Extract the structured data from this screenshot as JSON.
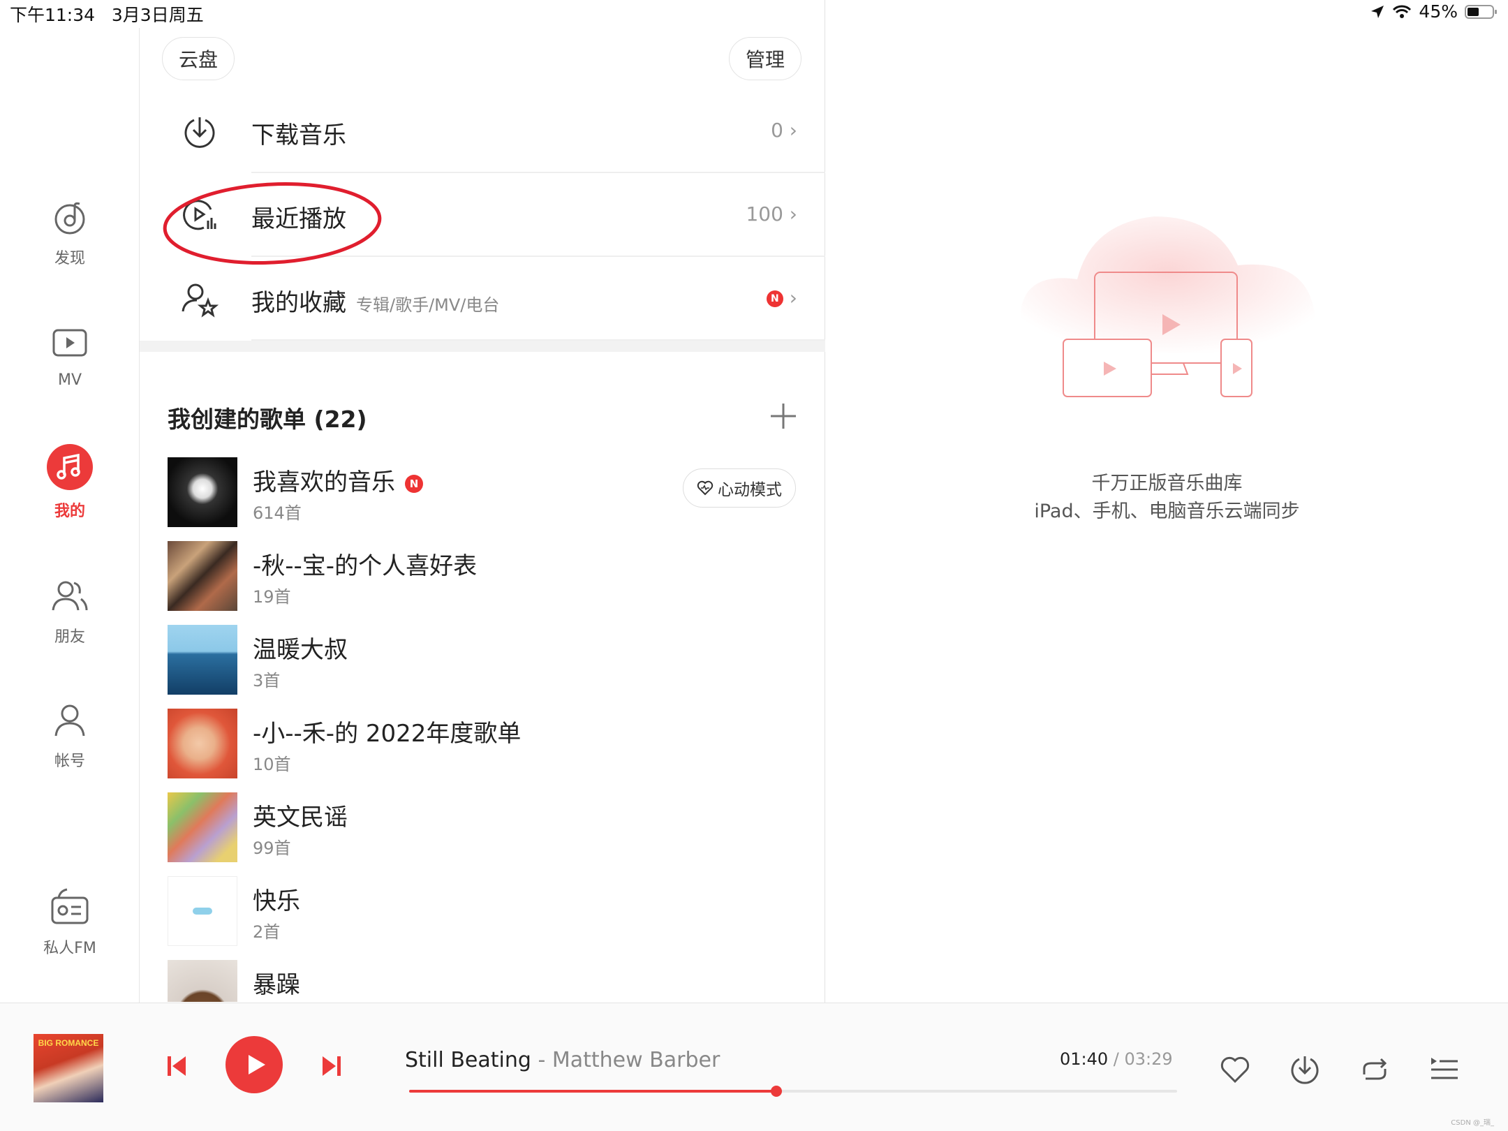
{
  "status_bar": {
    "time": "下午11:34",
    "date": "3月3日周五",
    "battery": "45%"
  },
  "nav": {
    "items": [
      {
        "label": "发现",
        "icon": "discover-icon",
        "active": false
      },
      {
        "label": "MV",
        "icon": "mv-play-icon",
        "active": false
      },
      {
        "label": "我的",
        "icon": "music-note-icon",
        "active": true
      },
      {
        "label": "朋友",
        "icon": "friends-icon",
        "active": false
      },
      {
        "label": "帐号",
        "icon": "account-icon",
        "active": false
      },
      {
        "label": "私人FM",
        "icon": "radio-icon",
        "active": false
      }
    ]
  },
  "top_buttons": {
    "cloud": "云盘",
    "manage": "管理"
  },
  "library": [
    {
      "label": "下载音乐",
      "icon": "download-icon",
      "count": "0"
    },
    {
      "label": "最近播放",
      "icon": "recent-play-icon",
      "count": "100"
    },
    {
      "label": "我的收藏",
      "sub": "专辑/歌手/MV/电台",
      "icon": "favorites-icon",
      "badge": "N"
    }
  ],
  "playlists": {
    "title": "我创建的歌单 (22)",
    "heart_mode": "心动模式",
    "items": [
      {
        "name": "我喜欢的音乐",
        "count": "614首",
        "badge": "N"
      },
      {
        "name": "-秋--宝-的个人喜好表",
        "count": "19首"
      },
      {
        "name": "温暖大叔",
        "count": "3首"
      },
      {
        "name": "-小--禾-的 2022年度歌单",
        "count": "10首"
      },
      {
        "name": "英文民谣",
        "count": "99首"
      },
      {
        "name": "快乐",
        "count": "2首"
      },
      {
        "name": "暴躁",
        "count": ""
      }
    ]
  },
  "promo": {
    "line1": "千万正版音乐曲库",
    "line2": "iPad、手机、电脑音乐云端同步"
  },
  "player": {
    "album_text": "BIG ROMANCE",
    "title": "Still Beating",
    "separator": " - ",
    "artist": "Matthew Barber",
    "current": "01:40",
    "slash": " / ",
    "total": "03:29",
    "progress": 0.478
  },
  "watermark": "CSDN @_瑞_",
  "colors": {
    "accent": "#ec3a3a"
  }
}
